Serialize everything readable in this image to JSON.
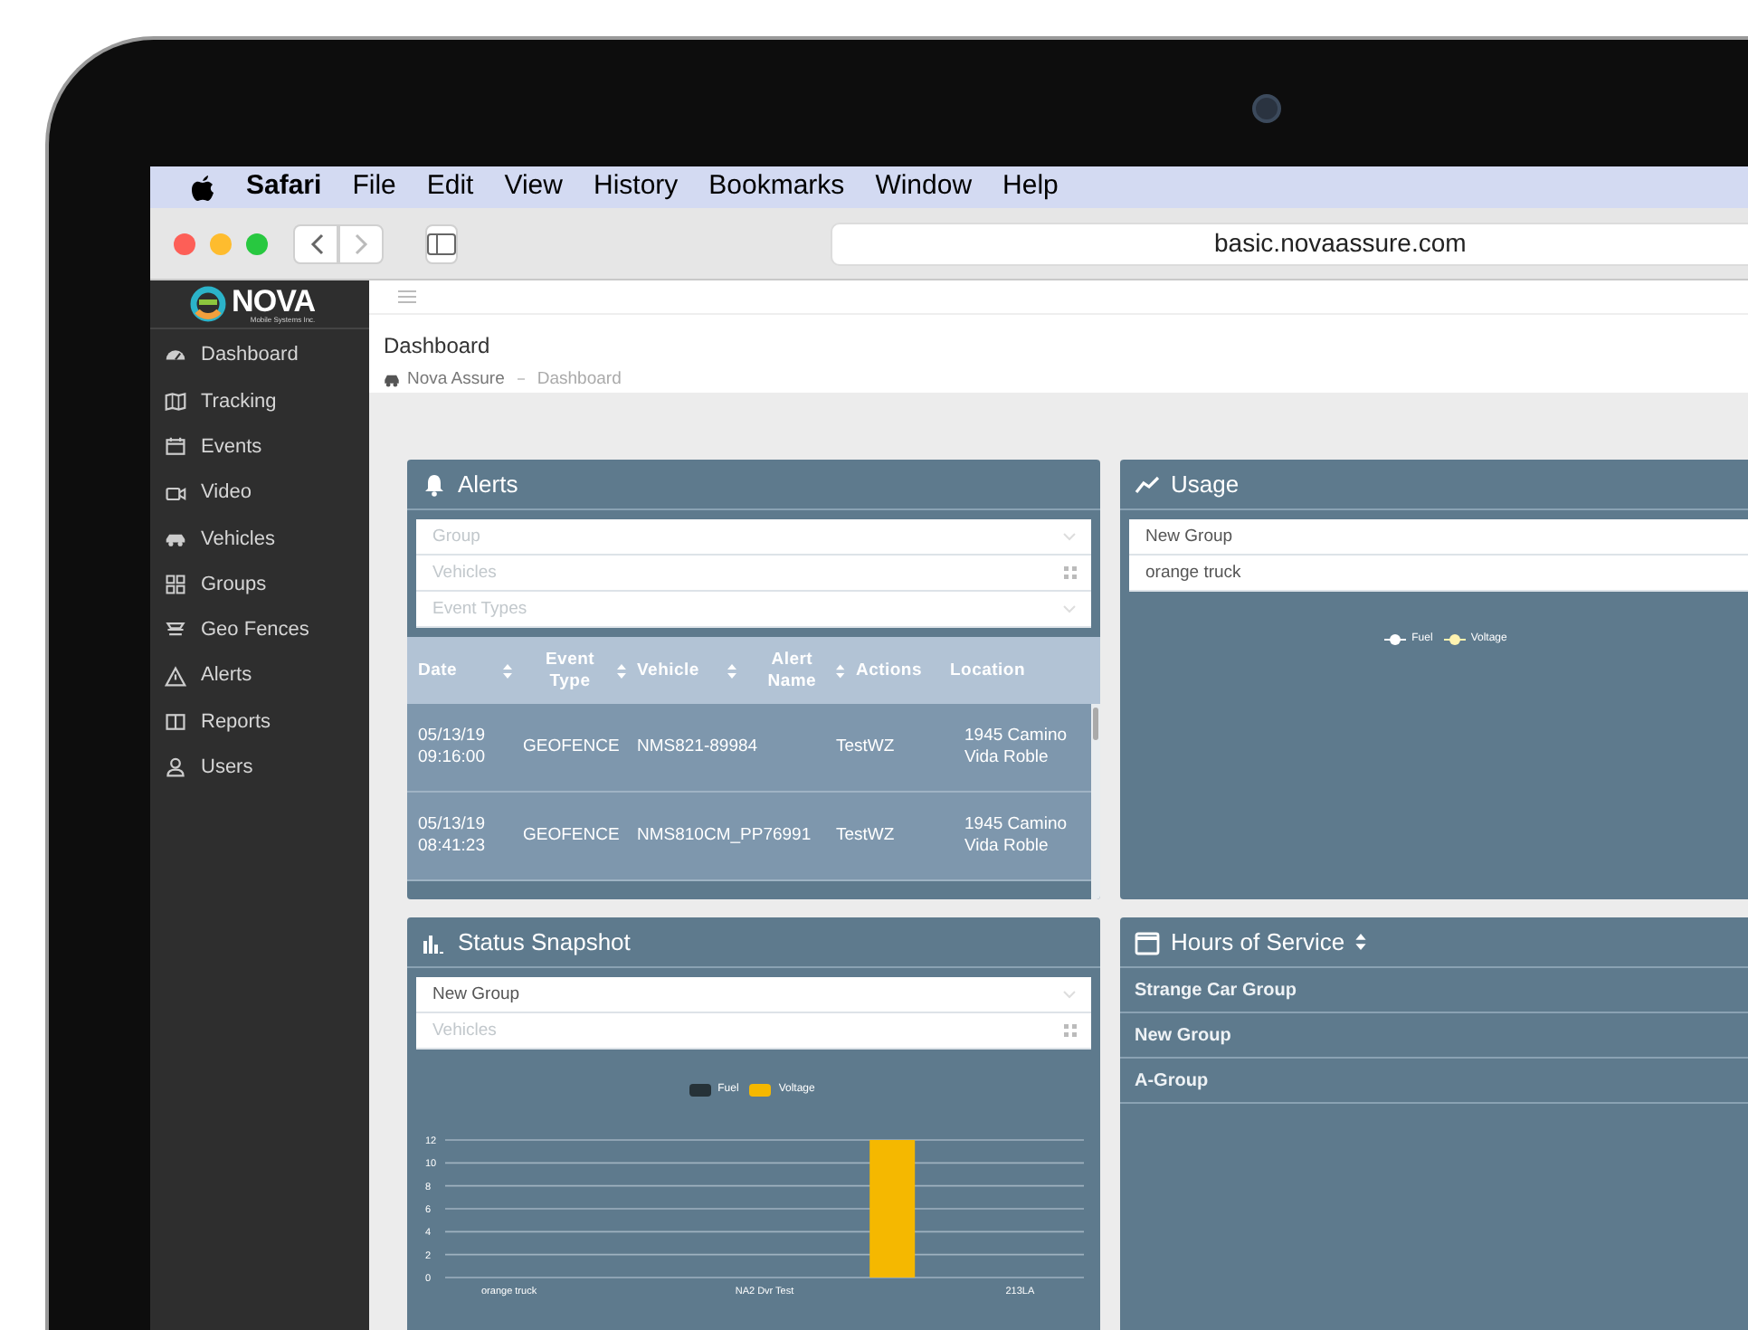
{
  "menu_bar": {
    "app": "Safari",
    "items": [
      "File",
      "Edit",
      "View",
      "History",
      "Bookmarks",
      "Window",
      "Help"
    ]
  },
  "toolbar": {
    "url": "basic.novaassure.com"
  },
  "sidebar": {
    "logo": "NOVA",
    "tagline": "Mobile Systems Inc.",
    "items": [
      {
        "label": "Dashboard",
        "selected": false
      },
      {
        "label": "Tracking",
        "selected": false
      },
      {
        "label": "Events",
        "selected": false
      },
      {
        "label": "Video",
        "selected": false
      },
      {
        "label": "Vehicles",
        "selected": false
      },
      {
        "label": "Groups",
        "selected": false
      },
      {
        "label": "Geo Fences",
        "selected": false
      },
      {
        "label": "Alerts",
        "selected": false
      },
      {
        "label": "Reports",
        "selected": false
      },
      {
        "label": "Users",
        "selected": false
      }
    ]
  },
  "page": {
    "title": "Dashboard",
    "breadcrumb": [
      "Nova Assure",
      "Dashboard"
    ]
  },
  "alerts": {
    "title": "Alerts",
    "filters": [
      {
        "kind": "select",
        "placeholder": "Group"
      },
      {
        "kind": "multi",
        "placeholder": "Vehicles"
      },
      {
        "kind": "select",
        "placeholder": "Event Types"
      }
    ],
    "table": {
      "columns": [
        {
          "label": "Date",
          "sortable": true
        },
        {
          "label": "Event Type",
          "sortable": true
        },
        {
          "label": "Vehicle",
          "sortable": true
        },
        {
          "label": "Alert Name",
          "sortable": true
        },
        {
          "label": "Actions",
          "sortable": false
        },
        {
          "label": "Location",
          "sortable": false
        }
      ],
      "rows": [
        [
          "05/13/19 09:16:00",
          "GEOFENCE",
          "NMS821-89984",
          "TestWZ",
          "",
          "1945 Camino Vida Roble"
        ],
        [
          "05/13/19 08:41:23",
          "GEOFENCE",
          "NMS810CM_PP76991",
          "TestWZ",
          "",
          "1945 Camino Vida Roble"
        ]
      ]
    }
  },
  "usage": {
    "title": "Usage",
    "filters": [
      {
        "value": "New Group"
      },
      {
        "value": "orange truck"
      }
    ],
    "legend": [
      {
        "label": "Fuel",
        "color": "#ffffff"
      },
      {
        "label": "Voltage",
        "color": "#fff3b0"
      }
    ]
  },
  "status_snapshot": {
    "title": "Status Snapshot",
    "filters": [
      {
        "kind": "select",
        "value": "New Group"
      },
      {
        "kind": "multi",
        "placeholder": "Vehicles"
      }
    ],
    "chart_data": {
      "type": "bar",
      "categories": [
        "orange truck",
        null,
        "NA2 Dvr Test",
        null,
        "213LA"
      ],
      "series": [
        {
          "name": "Fuel",
          "color": "#263238",
          "values": [
            0,
            0,
            0,
            0,
            0
          ]
        },
        {
          "name": "Voltage",
          "color": "#f5b800",
          "values": [
            0,
            0,
            0,
            12,
            0
          ]
        }
      ],
      "ylim": [
        0,
        12
      ],
      "yticks": [
        0,
        2,
        4,
        6,
        8,
        10,
        12
      ],
      "grid": true
    }
  },
  "hours_of_service": {
    "title": "Hours of Service",
    "groups": [
      "Strange Car Group",
      "New Group",
      "A-Group"
    ]
  }
}
